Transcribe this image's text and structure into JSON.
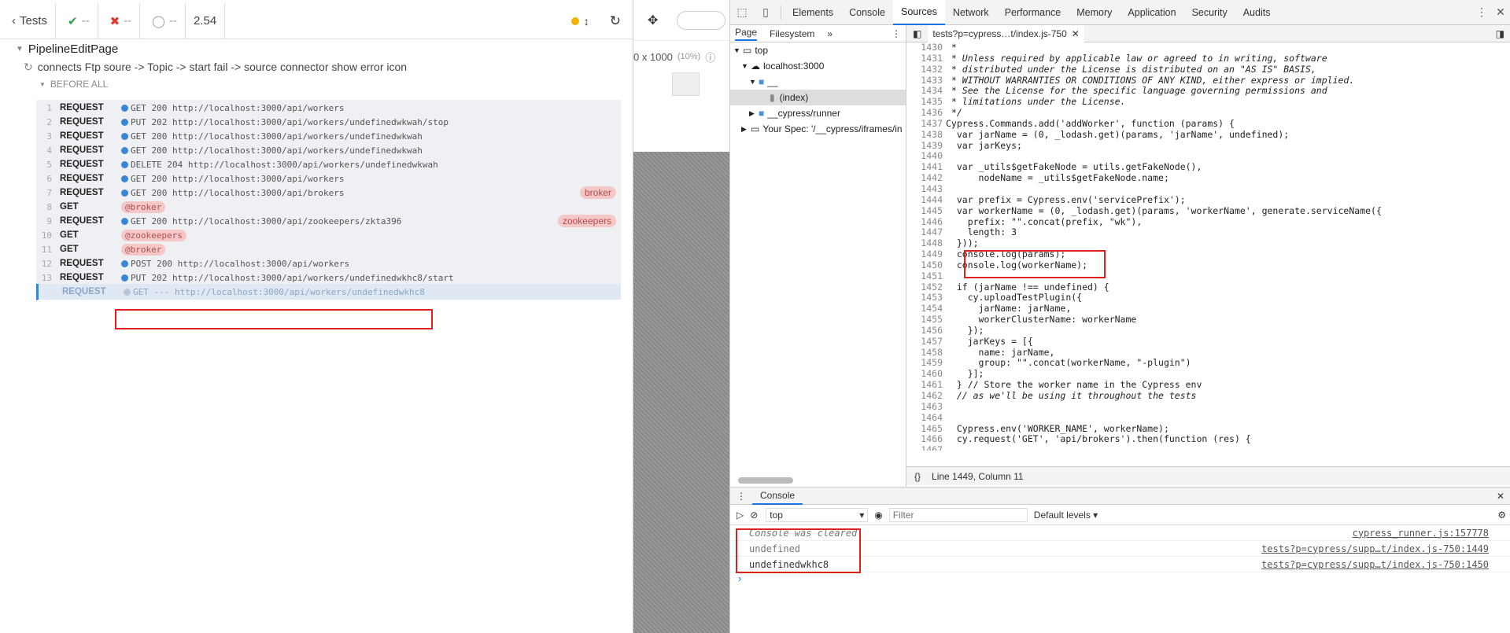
{
  "cypress": {
    "tests_label": "Tests",
    "passed": "--",
    "failed": "--",
    "pending": "--",
    "duration": "2.54",
    "suite": "PipelineEditPage",
    "test": "connects Ftp soure -> Topic -> start fail -> source connector show error icon",
    "hook": "BEFORE ALL",
    "commands": [
      {
        "n": "1",
        "name": "REQUEST",
        "msg": "GET 200 http://localhost:3000/api/workers"
      },
      {
        "n": "2",
        "name": "REQUEST",
        "msg": "PUT 202 http://localhost:3000/api/workers/undefinedwkwah/stop"
      },
      {
        "n": "3",
        "name": "REQUEST",
        "msg": "GET 200 http://localhost:3000/api/workers/undefinedwkwah"
      },
      {
        "n": "4",
        "name": "REQUEST",
        "msg": "GET 200 http://localhost:3000/api/workers/undefinedwkwah"
      },
      {
        "n": "5",
        "name": "REQUEST",
        "msg": "DELETE 204 http://localhost:3000/api/workers/undefinedwkwah"
      },
      {
        "n": "6",
        "name": "REQUEST",
        "msg": "GET 200 http://localhost:3000/api/workers"
      },
      {
        "n": "7",
        "name": "REQUEST",
        "msg": "GET 200 http://localhost:3000/api/brokers",
        "tag": "broker"
      },
      {
        "n": "8",
        "name": "GET",
        "alias": "@broker"
      },
      {
        "n": "9",
        "name": "REQUEST",
        "msg": "GET 200 http://localhost:3000/api/zookeepers/zkta396",
        "tag": "zookeepers"
      },
      {
        "n": "10",
        "name": "GET",
        "alias": "@zookeepers"
      },
      {
        "n": "11",
        "name": "GET",
        "alias": "@broker"
      },
      {
        "n": "12",
        "name": "REQUEST",
        "msg": "POST 200 http://localhost:3000/api/workers"
      },
      {
        "n": "13",
        "name": "REQUEST",
        "msg": "PUT 202 http://localhost:3000/api/workers/undefinedwkhc8/start"
      },
      {
        "n": "",
        "name": "REQUEST",
        "msg": "GET --- http://localhost:3000/api/workers/undefinedwkhc8",
        "pending": true
      }
    ]
  },
  "aut": {
    "size": "0 x 1000",
    "zoom": "(10%)"
  },
  "devtools": {
    "tabs": [
      "Elements",
      "Console",
      "Sources",
      "Network",
      "Performance",
      "Memory",
      "Application",
      "Security",
      "Audits"
    ],
    "active_tab": "Sources",
    "nav_tabs": [
      "Page",
      "Filesystem"
    ],
    "tree": [
      "top",
      "localhost:3000",
      "__",
      "(index)",
      "__cypress/runner",
      "Your Spec: '/__cypress/iframes/in"
    ],
    "file_tab": "tests?p=cypress…t/index.js-750",
    "status": "Line 1449, Column 11",
    "code": [
      {
        "n": "1430",
        "t": " *",
        "k": "cm"
      },
      {
        "n": "1431",
        "t": " * Unless required by applicable law or agreed to in writing, software",
        "k": "cm"
      },
      {
        "n": "1432",
        "t": " * distributed under the License is distributed on an \"AS IS\" BASIS,",
        "k": "cm"
      },
      {
        "n": "1433",
        "t": " * WITHOUT WARRANTIES OR CONDITIONS OF ANY KIND, either express or implied.",
        "k": "cm"
      },
      {
        "n": "1434",
        "t": " * See the License for the specific language governing permissions and",
        "k": "cm"
      },
      {
        "n": "1435",
        "t": " * limitations under the License.",
        "k": "cm"
      },
      {
        "n": "1436",
        "t": " */",
        "k": "cm"
      },
      {
        "n": "1437",
        "t": "Cypress.Commands.add('addWorker', function (params) {"
      },
      {
        "n": "1438",
        "t": "  var jarName = (0, _lodash.get)(params, 'jarName', undefined);"
      },
      {
        "n": "1439",
        "t": "  var jarKeys;"
      },
      {
        "n": "1440",
        "t": ""
      },
      {
        "n": "1441",
        "t": "  var _utils$getFakeNode = utils.getFakeNode(),"
      },
      {
        "n": "1442",
        "t": "      nodeName = _utils$getFakeNode.name;"
      },
      {
        "n": "1443",
        "t": ""
      },
      {
        "n": "1444",
        "t": "  var prefix = Cypress.env('servicePrefix');"
      },
      {
        "n": "1445",
        "t": "  var workerName = (0, _lodash.get)(params, 'workerName', generate.serviceName({"
      },
      {
        "n": "1446",
        "t": "    prefix: \"\".concat(prefix, \"wk\"),"
      },
      {
        "n": "1447",
        "t": "    length: 3"
      },
      {
        "n": "1448",
        "t": "  }));"
      },
      {
        "n": "1449",
        "t": "  console.log(params);"
      },
      {
        "n": "1450",
        "t": "  console.log(workerName);"
      },
      {
        "n": "1451",
        "t": ""
      },
      {
        "n": "1452",
        "t": "  if (jarName !== undefined) {"
      },
      {
        "n": "1453",
        "t": "    cy.uploadTestPlugin({"
      },
      {
        "n": "1454",
        "t": "      jarName: jarName,"
      },
      {
        "n": "1455",
        "t": "      workerClusterName: workerName"
      },
      {
        "n": "1456",
        "t": "    });"
      },
      {
        "n": "1457",
        "t": "    jarKeys = [{"
      },
      {
        "n": "1458",
        "t": "      name: jarName,"
      },
      {
        "n": "1459",
        "t": "      group: \"\".concat(workerName, \"-plugin\")"
      },
      {
        "n": "1460",
        "t": "    }];"
      },
      {
        "n": "1461",
        "t": "  } // Store the worker name in the Cypress env"
      },
      {
        "n": "1462",
        "t": "  // as we'll be using it throughout the tests",
        "k": "cm"
      },
      {
        "n": "1463",
        "t": ""
      },
      {
        "n": "1464",
        "t": ""
      },
      {
        "n": "1465",
        "t": "  Cypress.env('WORKER_NAME', workerName);"
      },
      {
        "n": "1466",
        "t": "  cy.request('GET', 'api/brokers').then(function (res) {"
      },
      {
        "n": "1467",
        "t": ""
      }
    ],
    "console_tab": "Console",
    "context": "top",
    "filter_placeholder": "Filter",
    "levels": "Default levels",
    "console_lines": [
      {
        "text": "Console was cleared",
        "src": "cypress_runner.js:157778",
        "muted": true
      },
      {
        "text": "undefined",
        "src": "tests?p=cypress/supp…t/index.js-750:1449",
        "muted": true
      },
      {
        "text": "undefinedwkhc8",
        "src": "tests?p=cypress/supp…t/index.js-750:1450"
      }
    ]
  }
}
